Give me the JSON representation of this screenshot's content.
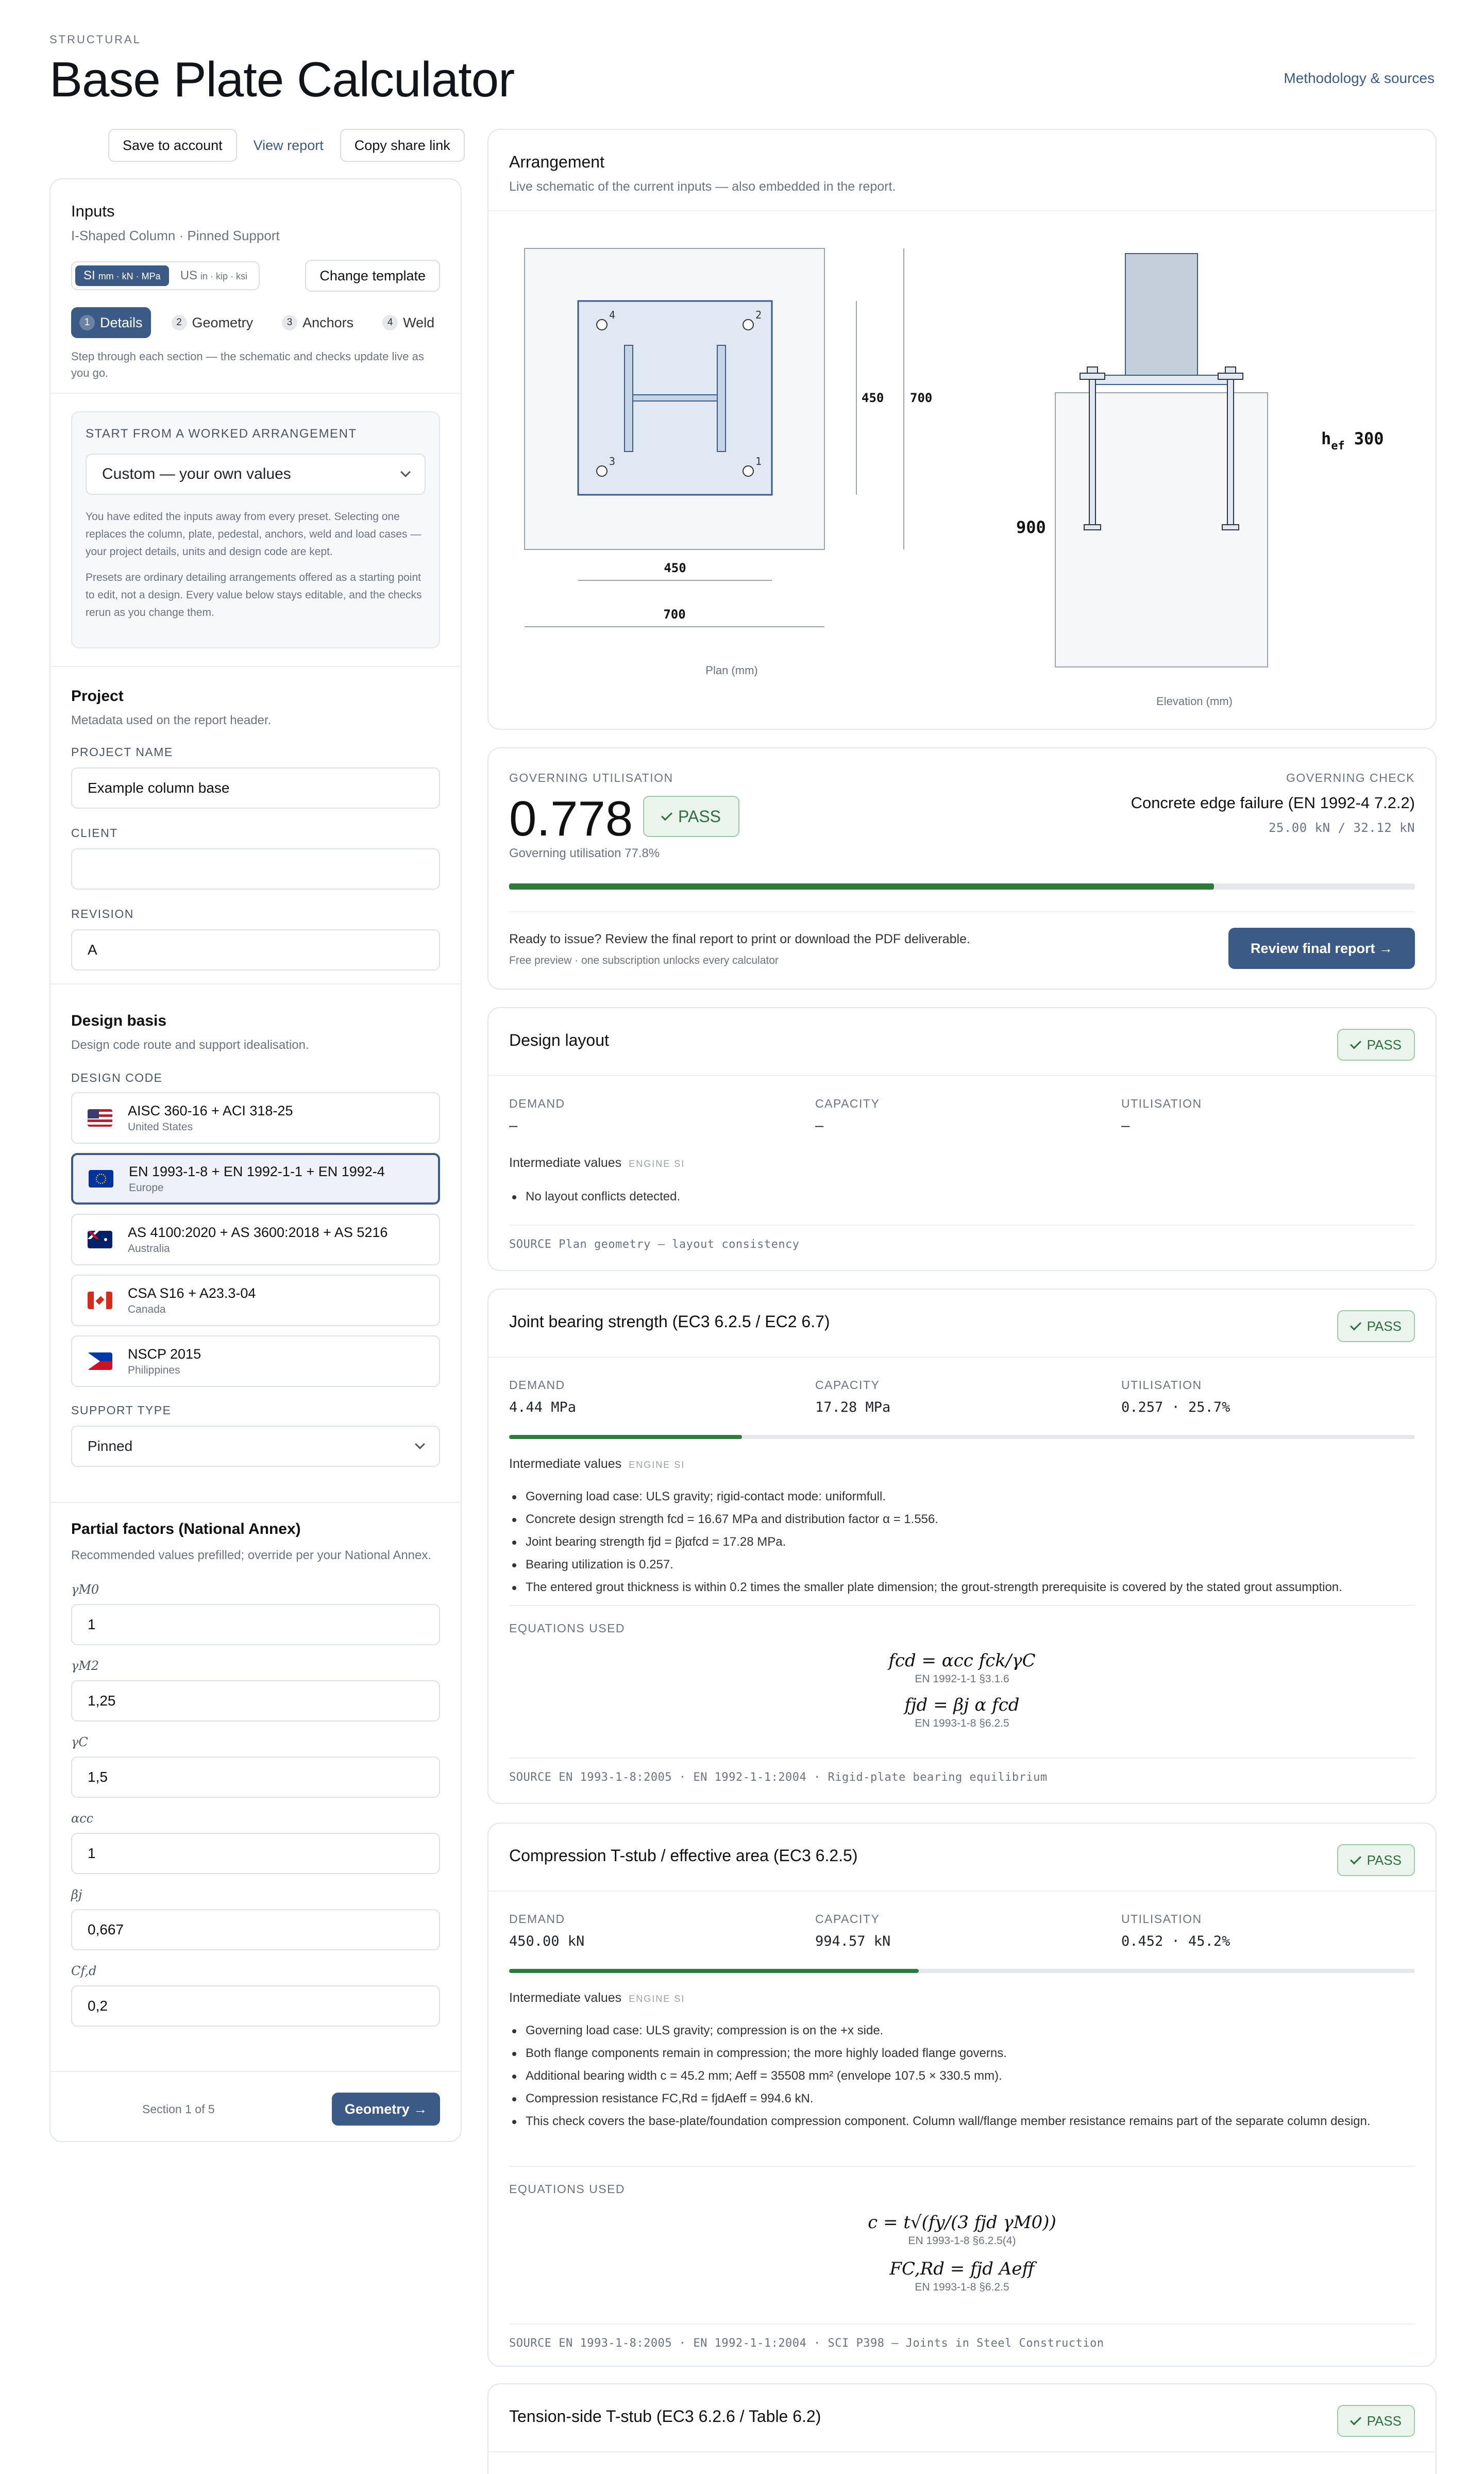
{
  "header": {
    "eyebrow": "STRUCTURAL",
    "title": "Base Plate Calculator",
    "methodology_link": "Methodology & sources"
  },
  "toolbar": {
    "save_label": "Save to account",
    "view_report_label": "View report",
    "copy_link_label": "Copy share link"
  },
  "inputs": {
    "title": "Inputs",
    "subtitle": "I-Shaped Column · Pinned Support",
    "units": [
      {
        "label": "SI",
        "detail": "mm · kN · MPa",
        "selected": true
      },
      {
        "label": "US",
        "detail": "in · kip · ksi",
        "selected": false
      }
    ],
    "change_template_label": "Change template",
    "steps": [
      {
        "num": "1",
        "label": "Details",
        "active": true
      },
      {
        "num": "2",
        "label": "Geometry",
        "active": false
      },
      {
        "num": "3",
        "label": "Anchors",
        "active": false
      },
      {
        "num": "4",
        "label": "Weld",
        "active": false
      }
    ],
    "steps_hint": "Step through each section — the schematic and checks update live as you go.",
    "preset": {
      "label": "START FROM A WORKED ARRANGEMENT",
      "selected": "Custom — your own values",
      "note1": "You have edited the inputs away from every preset. Selecting one replaces the column, plate, pedestal, anchors, weld and load cases — your project details, units and design code are kept.",
      "note2": "Presets are ordinary detailing arrangements offered as a starting point to edit, not a design. Every value below stays editable, and the checks rerun as you change them."
    },
    "project": {
      "title": "Project",
      "subtitle": "Metadata used on the report header.",
      "name_label": "PROJECT NAME",
      "name_value": "Example column base",
      "client_label": "CLIENT",
      "client_value": "",
      "revision_label": "REVISION",
      "revision_value": "A"
    },
    "design_basis": {
      "title": "Design basis",
      "subtitle": "Design code route and support idealisation.",
      "code_label": "DESIGN CODE",
      "codes": [
        {
          "name": "AISC 360-16 + ACI 318-25",
          "region": "United States",
          "flag": "us",
          "selected": false
        },
        {
          "name": "EN 1993-1-8 + EN 1992-1-1 + EN 1992-4",
          "region": "Europe",
          "flag": "eu",
          "selected": true
        },
        {
          "name": "AS 4100:2020 + AS 3600:2018 + AS 5216",
          "region": "Australia",
          "flag": "au",
          "selected": false
        },
        {
          "name": "CSA S16 + A23.3-04",
          "region": "Canada",
          "flag": "ca",
          "selected": false
        },
        {
          "name": "NSCP 2015",
          "region": "Philippines",
          "flag": "ph",
          "selected": false
        }
      ],
      "support_label": "SUPPORT TYPE",
      "support_value": "Pinned"
    },
    "partial_factors": {
      "title": "Partial factors (National Annex)",
      "subtitle": "Recommended values prefilled; override per your National Annex.",
      "fields": [
        {
          "label": "γM0",
          "value": "1"
        },
        {
          "label": "γM2",
          "value": "1,25"
        },
        {
          "label": "γC",
          "value": "1,5"
        },
        {
          "label": "αcc",
          "value": "1"
        },
        {
          "label": "βj",
          "value": "0,667"
        },
        {
          "label": "Cf,d",
          "value": "0,2"
        }
      ]
    },
    "footer": {
      "section_text": "Section 1 of 5",
      "next_label": "Geometry →"
    }
  },
  "arrangement": {
    "title": "Arrangement",
    "subtitle": "Live schematic of the current inputs — also embedded in the report.",
    "plan_caption": "Plan (mm)",
    "elevation_caption": "Elevation (mm)",
    "plan_dims": {
      "plate_w": "450",
      "ped_w": "700",
      "plate_h": "450",
      "ped_h": "700"
    },
    "anchor_numbers": [
      "4",
      "2",
      "3",
      "1"
    ],
    "elev_dims": {
      "ped_depth": "900",
      "hef_label": "h",
      "hef_sub": "ef",
      "hef_value": "300"
    }
  },
  "summary": {
    "gov_label": "GOVERNING UTILISATION",
    "gov_value": "0.778",
    "pass_label": "PASS",
    "gov_percent_text": "Governing utilisation 77.8%",
    "utilisation": 0.778,
    "check_label": "GOVERNING CHECK",
    "check_name": "Concrete edge failure (EN 1992-4 7.2.2)",
    "check_values": "25.00 kN / 32.12 kN",
    "issue_text": "Ready to issue? Review the final report to print or download the PDF deliverable.",
    "issue_sub": "Free preview · one subscription unlocks every calculator",
    "review_label": "Review final report →"
  },
  "checks": [
    {
      "title": "Design layout",
      "badge": "PASS",
      "demand_label": "DEMAND",
      "demand": "—",
      "capacity_label": "CAPACITY",
      "capacity": "—",
      "util_label": "UTILISATION",
      "util": "—",
      "intermediate_label": "Intermediate values",
      "engine_tag": "ENGINE SI",
      "bullets": [
        "No layout conflicts detected."
      ],
      "source": "SOURCE  Plan geometry — layout consistency"
    },
    {
      "title": "Joint bearing strength (EC3 6.2.5 / EC2 6.7)",
      "badge": "PASS",
      "demand_label": "DEMAND",
      "demand": "4.44 MPa",
      "capacity_label": "CAPACITY",
      "capacity": "17.28 MPa",
      "util_label": "UTILISATION",
      "util": "0.257 · 25.7%",
      "ratio": 0.257,
      "intermediate_label": "Intermediate values",
      "engine_tag": "ENGINE SI",
      "bullets": [
        "Governing load case: ULS gravity; rigid-contact mode: uniformfull.",
        "Concrete design strength fcd = 16.67 MPa and distribution factor α = 1.556.",
        "Joint bearing strength fjd = βjαfcd = 17.28 MPa.",
        "Bearing utilization is 0.257.",
        "The entered grout thickness is within 0.2 times the smaller plate dimension; the grout-strength prerequisite is covered by the stated grout assumption."
      ],
      "equations_label": "EQUATIONS USED",
      "equations": [
        {
          "eq": "fcd = αcc fck/γC",
          "ref": "EN 1992-1-1 §3.1.6"
        },
        {
          "eq": "fjd = βj α fcd",
          "ref": "EN 1993-1-8 §6.2.5"
        }
      ],
      "source": "SOURCE  EN 1993-1-8:2005 · EN 1992-1-1:2004 · Rigid-plate bearing equilibrium"
    },
    {
      "title": "Compression T-stub / effective area (EC3 6.2.5)",
      "badge": "PASS",
      "demand_label": "DEMAND",
      "demand": "450.00 kN",
      "capacity_label": "CAPACITY",
      "capacity": "994.57 kN",
      "util_label": "UTILISATION",
      "util": "0.452 · 45.2%",
      "ratio": 0.452,
      "intermediate_label": "Intermediate values",
      "engine_tag": "ENGINE SI",
      "bullets": [
        "Governing load case: ULS gravity; compression is on the +x side.",
        "Both flange components remain in compression; the more highly loaded flange governs.",
        "Additional bearing width c = 45.2 mm; Aeff = 35508 mm² (envelope 107.5 × 330.5 mm).",
        "Compression resistance FC,Rd = fjdAeff = 994.6 kN.",
        "This check covers the base-plate/foundation compression component. Column wall/flange member resistance remains part of the separate column design."
      ],
      "equations_label": "EQUATIONS USED",
      "equations": [
        {
          "eq": "c = t√(fy/(3 fjd γM0))",
          "ref": "EN 1993-1-8 §6.2.5(4)"
        },
        {
          "eq": "FC,Rd = fjd Aeff",
          "ref": "EN 1993-1-8 §6.2.5"
        }
      ],
      "source": "SOURCE  EN 1993-1-8:2005 · EN 1992-1-1:2004 · SCI P398 — Joints in Steel Construction"
    },
    {
      "title": "Tension-side T-stub (EC3 6.2.6 / Table 6.2)",
      "badge": "PASS"
    }
  ],
  "colors": {
    "accent": "#3b5a86",
    "pass": "#2f7a3d",
    "pass_bg": "#eaf4ec"
  }
}
